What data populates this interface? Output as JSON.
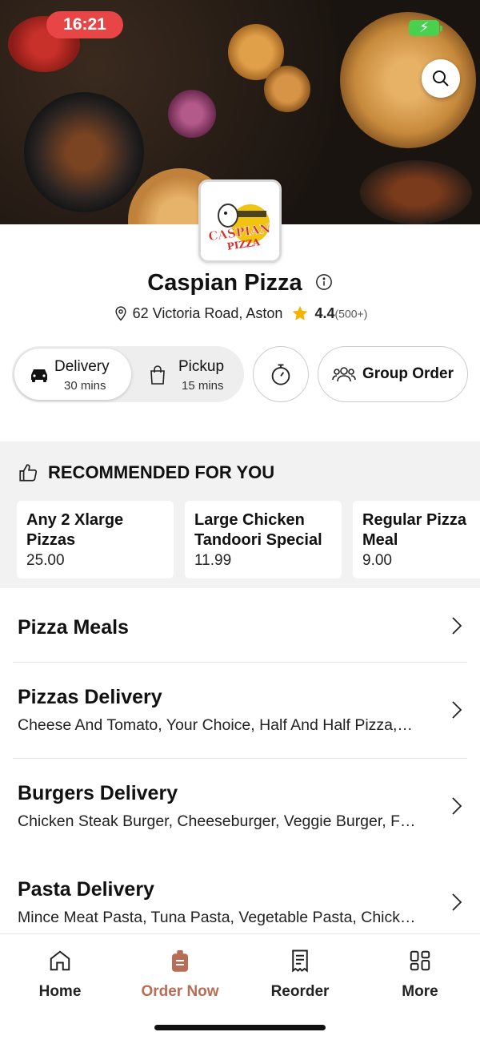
{
  "status": {
    "time": "16:21"
  },
  "restaurant": {
    "name": "Caspian Pizza",
    "logo_text_top": "CASPIAN",
    "logo_text_bottom": "PIZZA",
    "address": "62 Victoria Road, Aston",
    "rating": "4.4",
    "rating_count": "(500+)"
  },
  "fulfilment": {
    "delivery_label": "Delivery",
    "delivery_time": "30 mins",
    "pickup_label": "Pickup",
    "pickup_time": "15 mins",
    "selected": "Delivery"
  },
  "group_order_label": "Group Order",
  "recommended": {
    "heading": "RECOMMENDED FOR YOU",
    "items": [
      {
        "name_line1": "Any 2 Xlarge",
        "name_line2": "Pizzas",
        "price": "25.00"
      },
      {
        "name_line1": "Large Chicken",
        "name_line2": "Tandoori Special",
        "price": "11.99"
      },
      {
        "name_line1": "Regular Pizza",
        "name_line2": "Meal",
        "price": "9.00"
      }
    ]
  },
  "menu": [
    {
      "title": "Pizza Meals",
      "desc": ""
    },
    {
      "title": "Pizzas Delivery",
      "desc": "Cheese And Tomato, Your Choice, Half And Half Pizza,…"
    },
    {
      "title": "Burgers Delivery",
      "desc": "Chicken Steak Burger, Cheeseburger, Veggie Burger, F…"
    },
    {
      "title": "Pasta Delivery",
      "desc": "Mince Meat Pasta, Tuna Pasta, Vegetable Pasta, Chick…"
    }
  ],
  "nav": [
    {
      "label": "Home"
    },
    {
      "label": "Order Now"
    },
    {
      "label": "Reorder"
    },
    {
      "label": "More"
    }
  ],
  "colors": {
    "accent": "#b86d56",
    "star": "#f5b400",
    "status_pill": "#e84646",
    "battery": "#49d04f"
  }
}
